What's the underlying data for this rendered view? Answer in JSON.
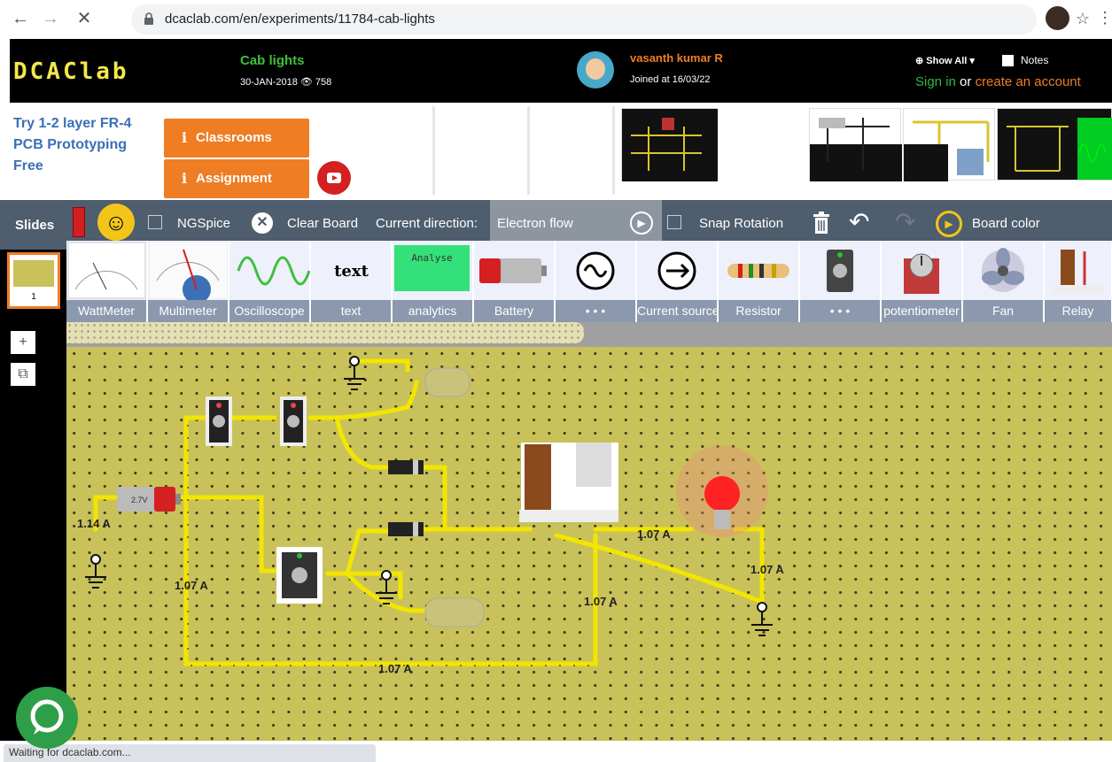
{
  "browser": {
    "url": "dcaclab.com/en/experiments/11784-cab-lights",
    "status": "Waiting for dcaclab.com..."
  },
  "header": {
    "logo": "DCAClab",
    "title": "Cab lights",
    "date": "30-JAN-2018",
    "views": "758",
    "user_name": "vasanth kumar R",
    "joined": "Joined at 16/03/22",
    "show_all": "Show All",
    "notes": "Notes",
    "sign_in": "Sign in",
    "or": "or",
    "create_account": "create an account"
  },
  "promo": {
    "pcb_text": "Try 1-2 layer FR-4 PCB Prototyping Free",
    "classrooms": "Classrooms",
    "assignment": "Assignment"
  },
  "toolbar": {
    "slides": "Slides",
    "ngspice": "NGSpice",
    "clear_board": "Clear Board",
    "current_direction": "Current direction:",
    "electron_flow": "Electron flow",
    "snap_rotation": "Snap Rotation",
    "board_color": "Board color"
  },
  "palette": [
    {
      "label": "WattMeter"
    },
    {
      "label": "Multimeter"
    },
    {
      "label": "Oscilloscope"
    },
    {
      "label": "text",
      "preview": "text"
    },
    {
      "label": "analytics",
      "preview": "Analyse"
    },
    {
      "label": "Battery"
    },
    {
      "label": "• • •"
    },
    {
      "label": "Current source"
    },
    {
      "label": "Resistor"
    },
    {
      "label": "• • •"
    },
    {
      "label": "potentiometer"
    },
    {
      "label": "Fan"
    },
    {
      "label": "Relay"
    }
  ],
  "left_panel": {
    "slide_number": "1",
    "add": "+"
  },
  "board": {
    "battery_label": "2.7V",
    "currents": [
      "1.14 A",
      "1.07 A",
      "1.07 A",
      "1.07 A",
      "1.07 A",
      "1.07 A"
    ]
  },
  "colors": {
    "board": "#c9c15a",
    "wire": "#f2e600",
    "accent": "#ee7d24",
    "toolbar": "#4e5e6f"
  }
}
